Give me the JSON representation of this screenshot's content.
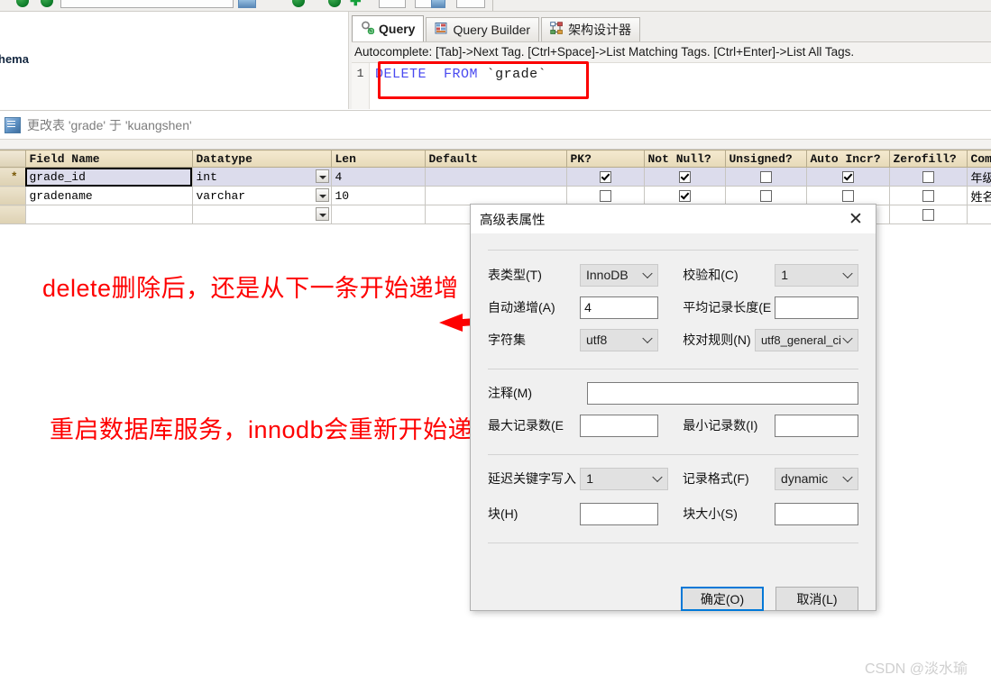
{
  "toolbar": {
    "icons": [
      "refresh-green-icon",
      "address-field",
      "blue-panel-icon",
      "download-green-icon",
      "upload-green-icon",
      "add-green-icon",
      "small-button-1",
      "small-button-2",
      "small-button-3"
    ]
  },
  "schema_pane": {
    "label": "hema"
  },
  "query_pane": {
    "tabs": [
      {
        "label": "Query",
        "icon": "query-magnifier-icon",
        "active": true
      },
      {
        "label": "Query Builder",
        "icon": "query-builder-icon",
        "active": false
      },
      {
        "label": "架构设计器",
        "icon": "schema-designer-icon",
        "active": false
      }
    ],
    "autocomplete_hint": "Autocomplete: [Tab]->Next Tag. [Ctrl+Space]->List Matching Tags. [Ctrl+Enter]->List All Tags.",
    "line_number": "1",
    "sql": {
      "keyword1": "DELETE",
      "keyword2": "FROM",
      "backtick_open": "`",
      "table": "grade",
      "backtick_close": "`"
    },
    "highlight_color": "#fb0000"
  },
  "editor_title": {
    "icon": "table-edit-icon",
    "text": "更改表 'grade' 于 'kuangshen'"
  },
  "grid": {
    "columns": [
      "",
      "Field Name",
      "Datatype",
      "Len",
      "Default",
      "PK?",
      "Not Null?",
      "Unsigned?",
      "Auto Incr?",
      "Zerofill?",
      "Comment"
    ],
    "rows": [
      {
        "marker": "*",
        "field_name": "grade_id",
        "datatype": "int",
        "len": "4",
        "default": "",
        "pk": true,
        "not_null": true,
        "unsigned": false,
        "auto_incr": true,
        "zerofill": false,
        "comment": "年级",
        "selected": true
      },
      {
        "marker": "",
        "field_name": "gradename",
        "datatype": "varchar",
        "len": "10",
        "default": "",
        "pk": false,
        "not_null": true,
        "unsigned": false,
        "auto_incr": false,
        "zerofill": false,
        "comment": "姓名",
        "selected": false
      },
      {
        "marker": "",
        "field_name": "",
        "datatype": "",
        "len": "",
        "default": "",
        "pk": false,
        "not_null": false,
        "unsigned": false,
        "auto_incr": false,
        "zerofill": false,
        "comment": "",
        "selected": false
      }
    ]
  },
  "annotations": {
    "note1": "delete删除后，还是从下一条开始递增",
    "note2": "重启数据库服务，innodb会重新开始递增",
    "color": "#fe0000",
    "arrow": "left-arrow-annotation"
  },
  "dialog": {
    "title": "高级表属性",
    "close_icon": "close-icon",
    "fields": {
      "table_type_label": "表类型(T)",
      "table_type_value": "InnoDB",
      "checksum_label": "校验和(C)",
      "checksum_value": "1",
      "auto_increment_label": "自动递增(A)",
      "auto_increment_value": "4",
      "avg_row_length_label": "平均记录长度(E",
      "avg_row_length_value": "",
      "charset_label": "字符集",
      "charset_value": "utf8",
      "collation_label": "校对规则(N)",
      "collation_value": "utf8_general_ci",
      "comment_label": "注释(M)",
      "comment_value": "",
      "max_rows_label": "最大记录数(E",
      "max_rows_value": "",
      "min_rows_label": "最小记录数(I)",
      "min_rows_value": "",
      "delay_key_write_label": "延迟关键字写入",
      "delay_key_write_value": "1",
      "row_format_label": "记录格式(F)",
      "row_format_value": "dynamic",
      "pack_keys_label": "块(H)",
      "pack_keys_value": "",
      "block_size_label": "块大小(S)",
      "block_size_value": ""
    },
    "buttons": {
      "ok": "确定(O)",
      "cancel": "取消(L)"
    },
    "accent_color": "#0078d7"
  },
  "watermark": "CSDN @淡水瑜"
}
